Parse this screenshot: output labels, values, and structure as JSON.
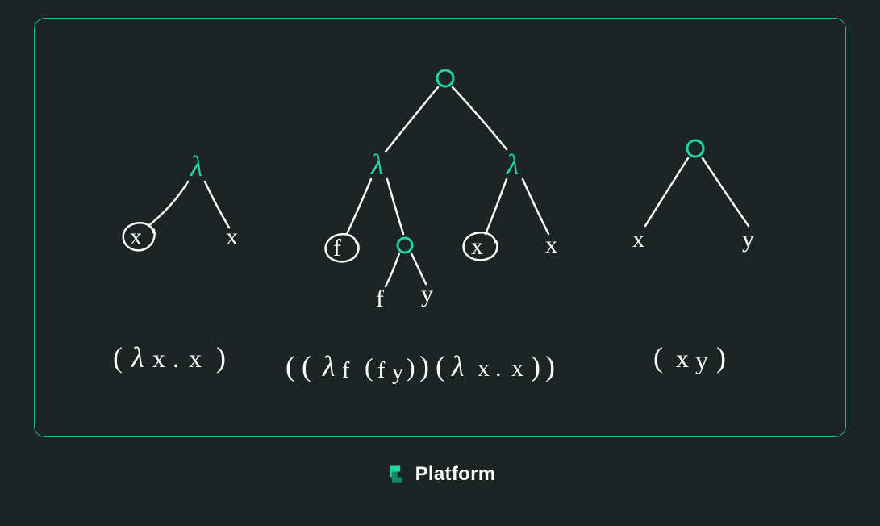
{
  "brand": {
    "name": "Platform"
  },
  "figure": {
    "accent_color": "#1fd6a3",
    "chalk_color": "#fcfcfc",
    "background_color": "#1d2424",
    "trees": [
      {
        "id": "identity",
        "root": {
          "type": "abstraction",
          "symbol": "λ"
        },
        "left": {
          "type": "binder",
          "label": "x",
          "circled": true
        },
        "right": {
          "type": "var",
          "label": "x"
        },
        "caption_tokens": [
          "(",
          "λ",
          "x",
          ".",
          " ",
          "x",
          ")"
        ]
      },
      {
        "id": "application-of-abstractions",
        "root": {
          "type": "application",
          "symbol": "○"
        },
        "left": {
          "type": "abstraction",
          "symbol": "λ",
          "left": {
            "type": "binder",
            "label": "f",
            "circled": true
          },
          "right": {
            "type": "application",
            "symbol": "○",
            "left": {
              "type": "var",
              "label": "f"
            },
            "right": {
              "type": "var",
              "label": "y"
            }
          }
        },
        "right": {
          "type": "abstraction",
          "symbol": "λ",
          "left": {
            "type": "binder",
            "label": "x",
            "circled": true
          },
          "right": {
            "type": "var",
            "label": "x"
          }
        },
        "caption_tokens": [
          "(",
          "(",
          " ",
          "λ",
          "f",
          " ",
          "(",
          "f",
          "y",
          ")",
          ")",
          "(",
          "λ",
          " ",
          "x",
          ".",
          " ",
          "x",
          ")",
          ")"
        ]
      },
      {
        "id": "simple-application",
        "root": {
          "type": "application",
          "symbol": "○"
        },
        "left": {
          "type": "var",
          "label": "x"
        },
        "right": {
          "type": "var",
          "label": "y"
        },
        "caption_tokens": [
          "(",
          " ",
          "x",
          "y",
          ")"
        ]
      }
    ]
  }
}
